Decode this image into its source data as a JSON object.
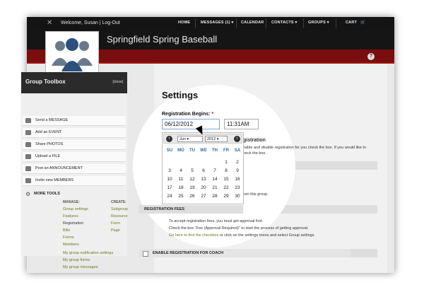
{
  "topbar": {
    "welcome": "Welcome, Susan | Log-Out",
    "nav": [
      "HOME",
      "MESSAGES (1) ▾",
      "CALENDAR",
      "CONTACTS ▾",
      "GROUPS ▾",
      "CART"
    ]
  },
  "header": {
    "group_name": "Springfield Spring Baseball"
  },
  "help_icon": "?",
  "sidebar": {
    "title": "Group Toolbox",
    "close_label": "[close]",
    "items": [
      {
        "label": "Send a MESSAGE",
        "icon": "envelope-icon"
      },
      {
        "label": "Add an EVENT",
        "icon": "calendar-icon"
      },
      {
        "label": "Share PHOTOS",
        "icon": "photo-icon"
      },
      {
        "label": "Upload a FILE",
        "icon": "file-icon"
      },
      {
        "label": "Post an ANNOUNCEMENT",
        "icon": "announcement-icon"
      },
      {
        "label": "Invite new MEMBERS",
        "icon": "members-icon"
      }
    ],
    "more_tools": "MORE TOOLS",
    "manage_label": "MANAGE:",
    "create_label": "CREATE:",
    "manage_links": [
      "Group settings",
      "Features",
      "Registration",
      "Bills",
      "Forms",
      "Members"
    ],
    "create_links": [
      "Subgroup",
      "Resource",
      "Form",
      "Page"
    ],
    "extra_links": [
      "My group notification settings",
      "My group forms",
      "My group messages"
    ]
  },
  "settings": {
    "title": "Settings",
    "registration_label": "Registration Begins:",
    "required_mark": "*",
    "date_value": "06/12/2012",
    "time_value": "11:31AM"
  },
  "calendar": {
    "month": "Jun",
    "year": "2012",
    "prev": "‹",
    "next": "›",
    "weekdays": [
      "SU",
      "MO",
      "TU",
      "WE",
      "TH",
      "FR",
      "SA"
    ],
    "weeks": [
      [
        "",
        "",
        "",
        "",
        "",
        "1",
        "2"
      ],
      [
        "3",
        "4",
        "5",
        "6",
        "7",
        "8",
        "9"
      ],
      [
        "10",
        "11",
        "12",
        "13",
        "14",
        "15",
        "16"
      ],
      [
        "17",
        "18",
        "19",
        "20",
        "21",
        "22",
        "23"
      ],
      [
        "24",
        "25",
        "26",
        "27",
        "28",
        "29",
        "30"
      ]
    ]
  },
  "right_fragments": {
    "registration_word": "gistration",
    "enable_text": "nable and disable registration for you check the box. If you would like to",
    "box_text": "heck the box.",
    "join_text": "join this group."
  },
  "registration_fees": {
    "heading": "REGISTRATION FEES",
    "line1": "To accept registration fees, you must get approval first.",
    "line2": "Check the box \"Fee (Approval Required)\" to start the process of getting approval.",
    "link_text": "Go here to find the checkbox",
    "line3_rest": " or click on the settings menu and select Group settings"
  },
  "coach_heading": "ENABLE REGISTRATION FOR COACH"
}
